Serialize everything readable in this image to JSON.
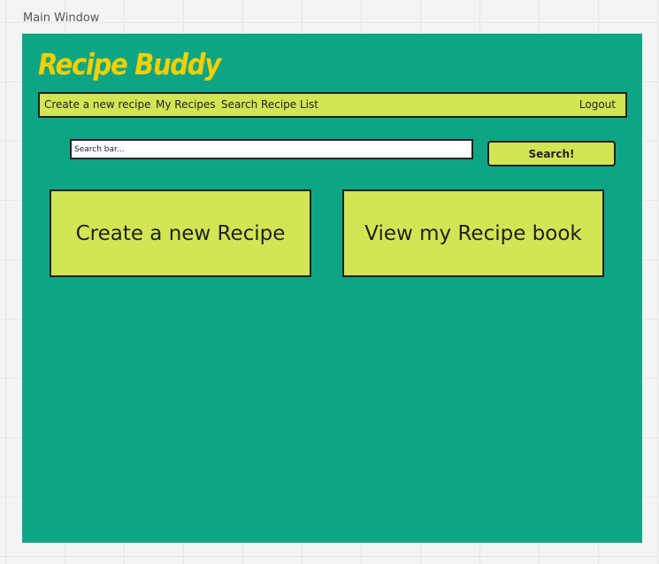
{
  "canvas": {
    "frame_label": "Main Window"
  },
  "app": {
    "title": "Recipe Buddy"
  },
  "nav": {
    "create": "Create a new recipe",
    "my_recipes": "My Recipes",
    "search_list": "Search Recipe List",
    "logout": "Logout"
  },
  "search": {
    "placeholder": "Search bar...",
    "button_label": "Search!"
  },
  "cards": {
    "create": "Create a new Recipe",
    "view": "View my Recipe book"
  },
  "colors": {
    "window_bg": "#0ea584",
    "accent": "#d2e554",
    "logo": "#f5d000",
    "border": "#222222"
  }
}
